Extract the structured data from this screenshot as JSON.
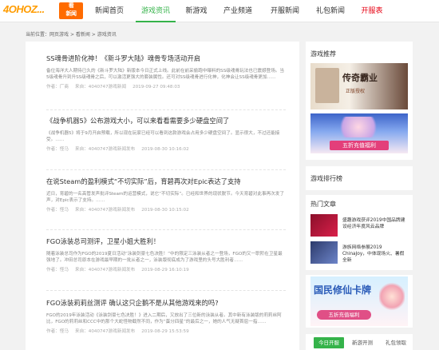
{
  "logo": {
    "text": "4OHOZ...",
    "mini_top": "看",
    "mini_bottom": "新闻"
  },
  "nav": [
    {
      "label": "新闻首页"
    },
    {
      "label": "游戏资讯"
    },
    {
      "label": "新游戏"
    },
    {
      "label": "产业频道"
    },
    {
      "label": "开服新闻"
    },
    {
      "label": "礼包新闻"
    },
    {
      "label": "开服表"
    }
  ],
  "breadcrumb": {
    "prefix": "当前位置：",
    "home": "网页游戏",
    "sep": " > ",
    "section": "看新闻",
    "current": "游戏资讯"
  },
  "articles": [
    {
      "title": "SS魂骨进阶化神！《新斗罗大陆》魂骨专场活动开启",
      "summary": "备位海洋大人期待已久的《新斗罗大陆》新版本今日正式上线。此前在前采偷跑中曝料的SS级魂骨玩法也已震撼登场。当5级魂骨升到升SS级魂骨之后，可以激活更强大的套装属性。还可对SS级魂骨进行化神，化神会让SS级魂骨更加……",
      "author": "作者：厂商",
      "source": "来自：4040747游戏新闻",
      "time": "2019-09-27 09:48:03"
    },
    {
      "title": "《战争机器5》公布游戏大小，可以来看看需要多少硬盘空间了",
      "summary": "《战争机器5》将于9月开启预载，所以现在玩家已经可以看到这款游戏会占用多少硬盘空间了。显示很大，不过还能接受。……",
      "author": "作者：怪马",
      "source": "来自：4040747游戏新闻发布",
      "time": "2019-08-30 10:16:02"
    },
    {
      "title": "在说Steam的盈利模式“不切实际”后，育碧再次对Epic表达了支持",
      "summary": "近日，育碧的一名高管发声批评Steam的运营模式，说它“不切实际”。已经和世界的现状脱节。今天育碧对此事再次发了声，对Epic表示了支持。……",
      "author": "作者：怪马",
      "source": "来自：4040747游戏新闻发布",
      "time": "2019-08-30 10:15:02"
    },
    {
      "title": "FGO泳装总司测评，卫星小姐大胜利！",
      "summary": "随着泳装总司作为FGO的2019夏日活动“泳装剑豪七色决胜！”中的限定三泳装从者之一登场，FGO的又一职阶在卫星最强地了。冲田总司原本在游戏最早期的一批从者之一，泳装版彻底成为了游戏里的头号大胜利者……",
      "author": "作者：怪马",
      "source": "来自：4040747游戏新闻发布",
      "time": "2019-08-29 16:10:19"
    },
    {
      "title": "FGO泳装莉莉丝测评 确认这只企鹅不是从其他游戏来的吗?",
      "summary": "FGO的2019年泳装活动《泳装剑豪七色决胜！》进入二期后，又放出了三位新的泳装从者。其中新有泳装版的莉莉丝阿比，FGO的莉莉丝和CCC中的那个大蛇怪物截然不同，作为“蛋分四星”的最后之一，她的人气无疑首屈一指……",
      "author": "作者：怪马",
      "source": "来自：4040747游戏新闻发布",
      "time": "2019-08-29 15:53:59"
    }
  ],
  "sidebar": {
    "recommend_title": "游戏推荐",
    "banner1": {
      "text": "传奇霸业",
      "sub": "正版授权"
    },
    "banner2": {
      "text": "五折充值福利"
    },
    "rank_title": "游戏排行榜",
    "hot_title": "热门文章",
    "hot": [
      {
        "text": "盛趣游戏获评2019中国品牌建设经济年度风云品牌"
      },
      {
        "text": "游族网络参展2019 ChinaJoy，中体现场火、暑假全新"
      }
    ],
    "banner3": {
      "text": "国民修仙卡牌",
      "sub": "五折充值福利"
    },
    "tabs": [
      {
        "label": "今日开服"
      },
      {
        "label": "新游开测"
      },
      {
        "label": "礼包领取"
      }
    ]
  },
  "colors": {
    "accent": "#35b34a",
    "hot": "#e60012",
    "logo": "#ff9c00"
  }
}
